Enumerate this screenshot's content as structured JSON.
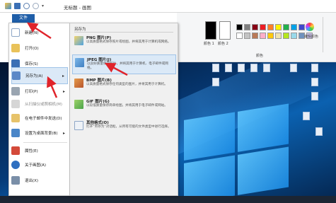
{
  "window": {
    "title": "无标题 - 画图"
  },
  "file_tab": {
    "label": "文件"
  },
  "file_menu": {
    "items": [
      {
        "label": "新建(N)"
      },
      {
        "label": "打开(O)"
      },
      {
        "label": "保存(S)"
      },
      {
        "label": "另存为(A)"
      },
      {
        "label": "打印(P)"
      },
      {
        "label": "从扫描仪或照相机(M)"
      },
      {
        "label": "在电子邮件中发送(D)"
      },
      {
        "label": "设置为桌面背景(B)"
      },
      {
        "label": "属性(E)"
      },
      {
        "label": "关于画图(A)"
      },
      {
        "label": "退出(X)"
      }
    ]
  },
  "save_as_menu": {
    "heading": "另存为",
    "items": [
      {
        "title": "PNG 图片(P)",
        "desc": "以高质量格式保存照片或绘图，并将其用于计算机或网络。"
      },
      {
        "title": "JPEG 图片(J)",
        "desc": "以良好质量保存照片，并将其用于计算机、电子邮件或网络。"
      },
      {
        "title": "BMP 图片(B)",
        "desc": "以高质量格式保存任何类型的图片，并将其用于计算机。"
      },
      {
        "title": "GIF 图片(G)",
        "desc": "以较低质量保存简单绘图，并将其用于电子邮件或网站。"
      },
      {
        "title": "其他格式(O)",
        "desc": "打开“另存为”对话框，从所有可能的文件类型中进行选择。"
      }
    ]
  },
  "ribbon": {
    "color1_label": "颜色 1",
    "color2_label": "颜色 2",
    "colors_group": "颜色",
    "edit_colors": "编辑颜色",
    "color1_value": "#000000",
    "color2_value": "#ffffff",
    "palette": [
      "#000000",
      "#7f7f7f",
      "#880015",
      "#ed1c24",
      "#ff7f27",
      "#fff200",
      "#22b14c",
      "#00a2e8",
      "#3f48cc",
      "#a349a4",
      "#ffffff",
      "#c3c3c3",
      "#b97a57",
      "#ffaec9",
      "#ffc90e",
      "#efe4b0",
      "#b5e61d",
      "#99d9ea",
      "#7092be",
      "#c8bfe7"
    ]
  },
  "annotation_color": "#e0242b"
}
